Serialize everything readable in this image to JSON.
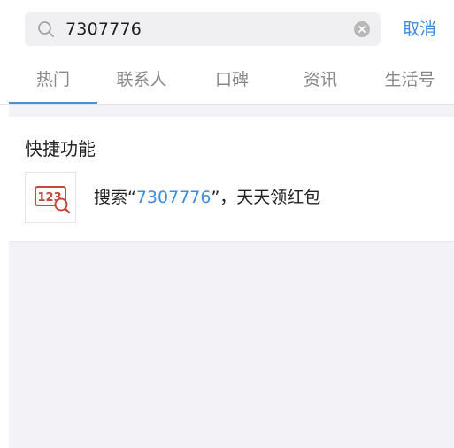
{
  "search": {
    "query": "7307776",
    "cancel_label": "取消",
    "icons": {
      "search": "search-icon",
      "clear": "clear-icon"
    }
  },
  "tabs": [
    {
      "label": "热门",
      "active": true
    },
    {
      "label": "联系人",
      "active": false
    },
    {
      "label": "口碑",
      "active": false
    },
    {
      "label": "资讯",
      "active": false
    },
    {
      "label": "生活号",
      "active": false
    }
  ],
  "quick_functions": {
    "title": "快捷功能",
    "item": {
      "icon_label": "123",
      "text_prefix": "搜索“",
      "text_highlight": "7307776",
      "text_suffix": "”，天天领红包"
    }
  },
  "colors": {
    "accent": "#3f8de0",
    "tab_indicator": "#4a90d9",
    "icon_red": "#c9473c",
    "background_gray": "#f3f3f7"
  }
}
